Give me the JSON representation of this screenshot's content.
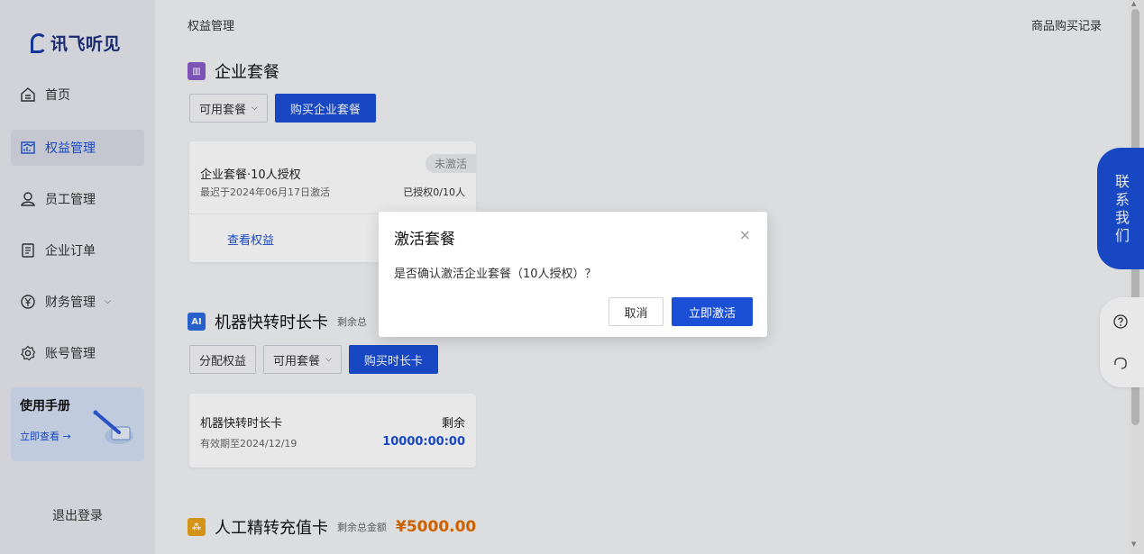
{
  "sidebar": {
    "logo_text": "讯飞听见",
    "items": [
      {
        "label": "首页",
        "icon": "home-icon"
      },
      {
        "label": "权益管理",
        "icon": "dashboard-icon"
      },
      {
        "label": "员工管理",
        "icon": "user-icon"
      },
      {
        "label": "企业订单",
        "icon": "document-icon"
      },
      {
        "label": "财务管理",
        "icon": "yen-icon"
      },
      {
        "label": "账号管理",
        "icon": "gear-icon"
      }
    ],
    "manual": {
      "title": "使用手册",
      "link": "立即查看 →"
    },
    "logout": "退出登录"
  },
  "header": {
    "breadcrumb": "权益管理",
    "purchase_record": "商品购买记录"
  },
  "enterprise": {
    "title": "企业套餐",
    "btn_available": "可用套餐",
    "btn_buy": "购买企业套餐",
    "card": {
      "name": "企业套餐·10人授权",
      "badge": "未激活",
      "activate_note": "最迟于2024年06月17日激活",
      "authorized": "已授权0/10人",
      "view_link": "查看权益"
    }
  },
  "machine": {
    "title": "机器快转时长卡",
    "sub": "剩余总",
    "btn_assign": "分配权益",
    "btn_available": "可用套餐",
    "btn_buy": "购买时长卡",
    "card": {
      "name": "机器快转时长卡",
      "validity": "有效期至2024/12/19",
      "remain_label": "剩余",
      "remain_value": "10000:00:00"
    }
  },
  "manual_card": {
    "title": "人工精转充值卡",
    "sub": "剩余总金额",
    "amount": "¥5000.00"
  },
  "dialog": {
    "title": "激活套餐",
    "close": "×",
    "message": "是否确认激活企业套餐（10人授权）？",
    "cancel": "取消",
    "confirm": "立即激活"
  },
  "float": {
    "contact": [
      "联",
      "系",
      "我",
      "们"
    ]
  },
  "colors": {
    "primary": "#1a4fd6",
    "amount": "#e06b00"
  }
}
